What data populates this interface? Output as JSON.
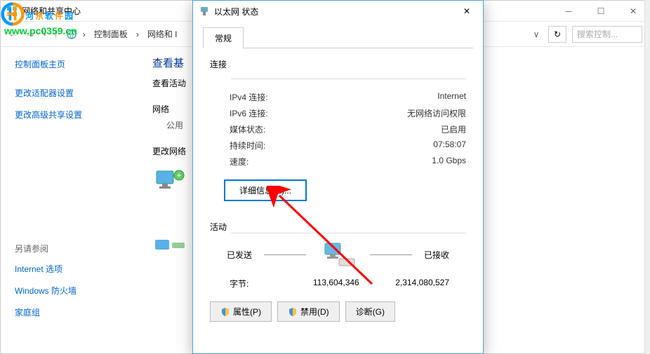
{
  "bg": {
    "title": "网络和共享中心",
    "crumbs": [
      "控制面板",
      "网络和 I"
    ],
    "search_placeholder": "搜索控制...",
    "heading": "查看基",
    "sub": "查看活动",
    "net_label": "网络",
    "net_type": "公用",
    "change_label": "更改网络",
    "sidebar": {
      "home": "控制面板主页",
      "adapter": "更改适配器设置",
      "advanced": "更改高级共享设置",
      "also": "另请参阅",
      "inet": "Internet 选项",
      "fw": "Windows 防火墙",
      "hg": "家庭组"
    }
  },
  "dlg": {
    "title": "以太网 状态",
    "tab": "常规",
    "conn_hdr": "连接",
    "rows": {
      "ipv4_l": "IPv4 连接:",
      "ipv4_v": "Internet",
      "ipv6_l": "IPv6 连接:",
      "ipv6_v": "无网络访问权限",
      "media_l": "媒体状态:",
      "media_v": "已启用",
      "dur_l": "持续时间:",
      "dur_v": "07:58:07",
      "speed_l": "速度:",
      "speed_v": "1.0 Gbps"
    },
    "detail_btn": "详细信息(E)...",
    "activity_hdr": "活动",
    "sent": "已发送",
    "recv": "已接收",
    "bytes_l": "字节:",
    "bytes_sent": "113,604,346",
    "bytes_recv": "2,314,080,527",
    "props": "属性(P)",
    "disable": "禁用(D)",
    "diag": "诊断(G)"
  },
  "wm": {
    "text": "河东软件园",
    "url": "www.pc0359.cn"
  }
}
